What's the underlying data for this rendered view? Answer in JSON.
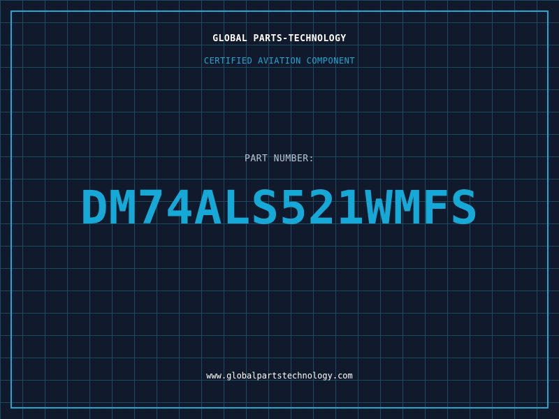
{
  "header": {
    "company_name": "GLOBAL PARTS-TECHNOLOGY",
    "tagline": "CERTIFIED AVIATION COMPONENT"
  },
  "part": {
    "label": "PART NUMBER:",
    "number": "DM74ALS521WMFS"
  },
  "footer": {
    "website": "www.globalpartstechnology.com"
  },
  "colors": {
    "background": "#111a2c",
    "grid": "#1d4a5e",
    "accent": "#1fa7d1",
    "part_number": "#16a8d6"
  }
}
